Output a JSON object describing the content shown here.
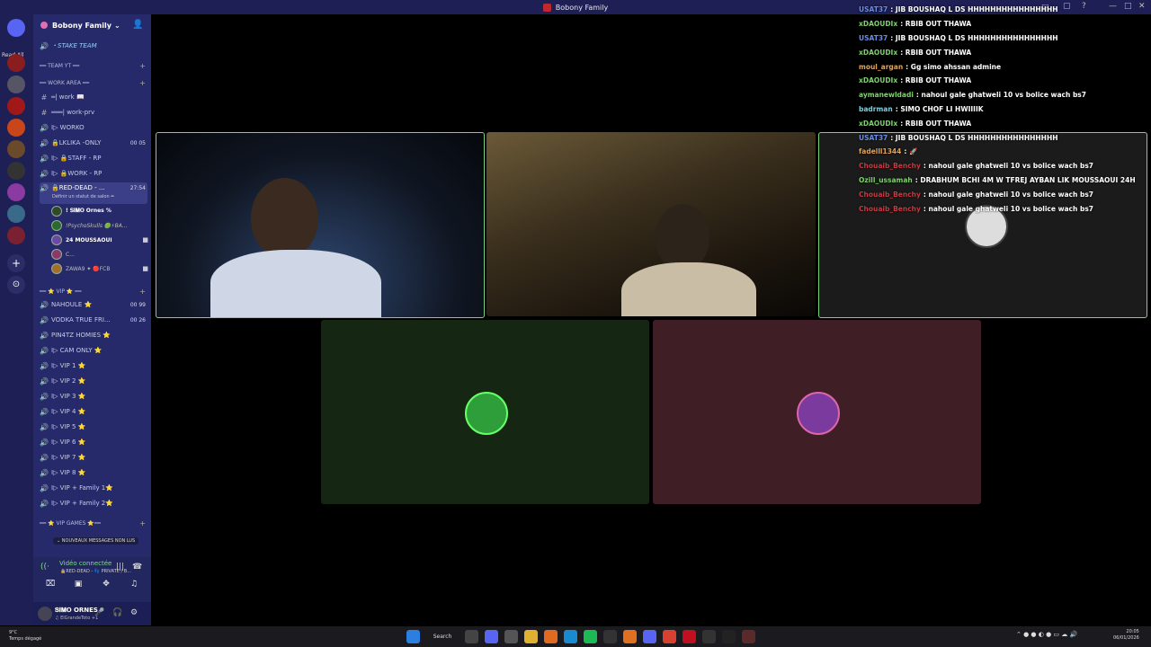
{
  "window": {
    "title": "Bobony Family"
  },
  "rail": {
    "read_all": "Read All"
  },
  "sidebar": {
    "server_name": "Bobony Family",
    "channels": [
      {
        "label": "・STAKE TEAM",
        "type": "voice"
      },
      {
        "label": "━━ TEAM YT ━━",
        "type": "category"
      },
      {
        "label": "━━ WORK AREA ━━",
        "type": "category"
      },
      {
        "label": "═| work 📖",
        "type": "text"
      },
      {
        "label": "═══| work-prv",
        "type": "text"
      },
      {
        "label": "I▷ WORKO",
        "type": "voice"
      },
      {
        "label": "🔒LKLIKA -ONLY",
        "type": "voice",
        "count": "00 05"
      },
      {
        "label": "I▷ 🔒STAFF - RP",
        "type": "voice"
      },
      {
        "label": "I▷ 🔒WORK - RP",
        "type": "voice"
      },
      {
        "label": "🔒RED-DEAD - ... ",
        "type": "voice",
        "count": "27:54",
        "status": "Définir un statut de salon ✏"
      },
      {
        "label": "━━ ⭐ VIP ⭐ ━━",
        "type": "category"
      },
      {
        "label": "NAHOULE ⭐",
        "type": "voice",
        "count": "00 99"
      },
      {
        "label": "VODKA TRUE FRI...",
        "type": "voice",
        "count": "00 26"
      },
      {
        "label": "PIN4TZ HOMIES ⭐",
        "type": "voice"
      },
      {
        "label": "I▷ CAM ONLY ⭐",
        "type": "voice"
      },
      {
        "label": "I▷ VIP 1 ⭐",
        "type": "voice"
      },
      {
        "label": "I▷ VIP 2 ⭐",
        "type": "voice"
      },
      {
        "label": "I▷ VIP 3 ⭐",
        "type": "voice"
      },
      {
        "label": "I▷ VIP 4 ⭐",
        "type": "voice"
      },
      {
        "label": "I▷ VIP 5 ⭐",
        "type": "voice"
      },
      {
        "label": "I▷ VIP 6 ⭐",
        "type": "voice"
      },
      {
        "label": "I▷ VIP 7 ⭐",
        "type": "voice"
      },
      {
        "label": "I▷ VIP 8 ⭐",
        "type": "voice"
      },
      {
        "label": "I▷ VIP + Family 1⭐",
        "type": "voice"
      },
      {
        "label": "I▷ VIP + Family 2⭐",
        "type": "voice"
      },
      {
        "label": "━━ ⭐ VIP GAMES ⭐━━",
        "type": "category"
      }
    ],
    "voice_users": [
      {
        "name": "! 𝐒𝐈𝐌𝐎 Ornes %"
      },
      {
        "name": "!PsychoSkulls 🟢⚡BA..."
      },
      {
        "name": "24 MOUSSAOUI"
      },
      {
        "name": "C..."
      },
      {
        "name": "ZAWA9 ✦ 🔴FCB"
      }
    ],
    "new_messages_tip": "⌄ NOUVEAUX MESSAGES NON LUS",
    "voice_connected": {
      "title": "Vidéo connectée",
      "subtitle": "🔒RED-DEAD - 👣 PRIVATE / B..."
    },
    "user_panel": {
      "name": "𝐒𝐈𝐌𝐎 ORNES",
      "status": "♫ ElGrandeToto +1"
    }
  },
  "chat": [
    {
      "user": "USAT37",
      "text": ": JIB BOUSHAQ L DS HHHHHHHHHHHHHHHH",
      "color": "#6b8ce0"
    },
    {
      "user": "xDAOUDIx",
      "text": ": RBIB OUT THAWA",
      "color": "#7cd36b"
    },
    {
      "user": "USAT37",
      "text": ": JIB BOUSHAQ L DS HHHHHHHHHHHHHHHH",
      "color": "#6b8ce0"
    },
    {
      "user": "xDAOUDIx",
      "text": ": RBIB OUT THAWA",
      "color": "#7cd36b"
    },
    {
      "user": "moul_argan",
      "text": ": Gg simo ahssan admine",
      "color": "#e0a35a"
    },
    {
      "user": "xDAOUDIx",
      "text": ": RBIB OUT THAWA",
      "color": "#7cd36b"
    },
    {
      "user": "aymanewldadi",
      "text": ": nahoul gale ghatweli 10 vs bolice wach bs7",
      "color": "#7cd36b"
    },
    {
      "user": "badrman",
      "text": ": SIMO CHOF LI HWIIIIK",
      "color": "#7ad0e0"
    },
    {
      "user": "xDAOUDIx",
      "text": ": RBIB OUT THAWA",
      "color": "#7cd36b"
    },
    {
      "user": "USAT37",
      "text": ": JIB BOUSHAQ L DS HHHHHHHHHHHHHHHH",
      "color": "#6b8ce0"
    },
    {
      "user": "fadelll1344",
      "text": ": 🚀",
      "color": "#e0a35a"
    },
    {
      "user": "Chouaib_Benchy",
      "text": ": nahoul gale ghatweli 10 vs bolice wach bs7",
      "color": "#c63a44"
    },
    {
      "user": "Ozill_ussamah",
      "text": ": DRABHUM BCHI 4M W TFREJ AYBAN LIK MOUSSAOUI 24H",
      "color": "#7cd36b"
    },
    {
      "user": "Chouaib_Benchy",
      "text": ": nahoul gale ghatweli 10 vs bolice wach bs7",
      "color": "#c63a44"
    },
    {
      "user": "Chouaib_Benchy",
      "text": ": nahoul gale ghatweli 10 vs bolice wach bs7",
      "color": "#c63a44"
    }
  ],
  "taskbar": {
    "weather_temp": "9°C",
    "weather_desc": "Temps dégagé",
    "search_label": "Search",
    "time": "20:05",
    "date": "06/01/2026"
  }
}
